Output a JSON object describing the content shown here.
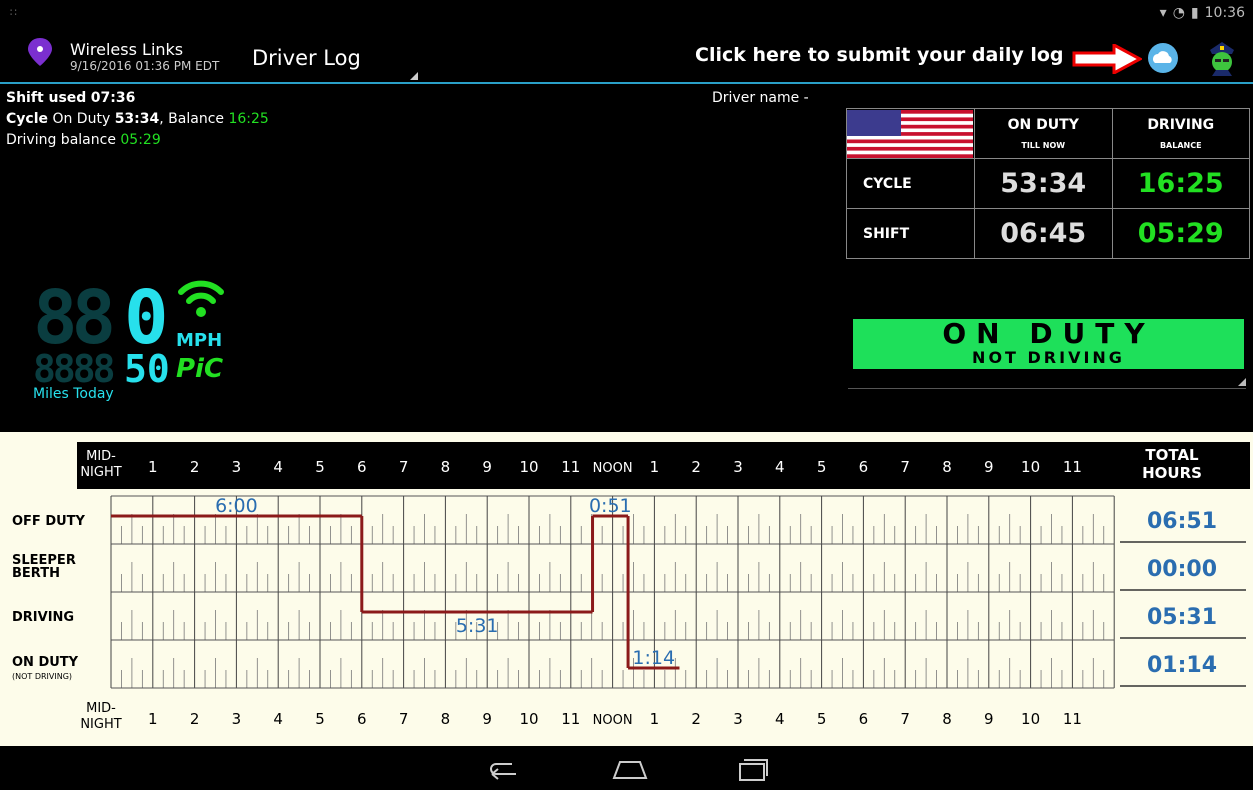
{
  "status_bar": {
    "time": "10:36",
    "icons": [
      "location-icon",
      "wifi-icon",
      "battery-icon"
    ]
  },
  "action_bar": {
    "app_name": "Wireless Links",
    "app_date": "9/16/2016 01:36 PM EDT",
    "screen_title": "Driver Log",
    "submit_hint": "Click here to submit your daily log"
  },
  "info": {
    "shift_label": "Shift used",
    "shift_value": "07:36",
    "cycle_label": "Cycle",
    "cycle_onduty_label": "On Duty",
    "cycle_onduty_value": "53:34",
    "balance_label": ", Balance",
    "balance_value": "16:25",
    "driving_balance_label": "Driving balance",
    "driving_balance_value": "05:29",
    "driver_name_label": "Driver name -"
  },
  "summary": {
    "col1_title": "ON DUTY",
    "col1_sub": "TILL NOW",
    "col2_title": "DRIVING",
    "col2_sub": "BALANCE",
    "rows": [
      {
        "label": "CYCLE",
        "on_duty": "53:34",
        "driving": "16:25"
      },
      {
        "label": "SHIFT",
        "on_duty": "06:45",
        "driving": "05:29"
      }
    ]
  },
  "status_banner": {
    "line1": "ON DUTY",
    "line2": "NOT DRIVING"
  },
  "speed": {
    "dim_digits": "88",
    "lit_digit": "0",
    "unit": "MPH",
    "odo_dim": "8888",
    "odo_lit": "50",
    "pic": "PiC",
    "miles_today": "Miles Today"
  },
  "log_grid": {
    "hour_labels": [
      "MID-NIGHT",
      "1",
      "2",
      "3",
      "4",
      "5",
      "6",
      "7",
      "8",
      "9",
      "10",
      "11",
      "NOON",
      "1",
      "2",
      "3",
      "4",
      "5",
      "6",
      "7",
      "8",
      "9",
      "10",
      "11"
    ],
    "total_header": "TOTAL HOURS",
    "rows": [
      {
        "label": "OFF DUTY",
        "sublabel": "",
        "total": "06:51"
      },
      {
        "label": "SLEEPER BERTH",
        "sublabel": "",
        "total": "00:00"
      },
      {
        "label": "DRIVING",
        "sublabel": "",
        "total": "05:31"
      },
      {
        "label": "ON DUTY",
        "sublabel": "(NOT DRIVING)",
        "total": "01:14"
      }
    ],
    "segments": [
      {
        "status_row": 0,
        "start_hour": 0,
        "end_hour": 6.0,
        "label": "6:00"
      },
      {
        "status_row": 2,
        "start_hour": 6.0,
        "end_hour": 11.52,
        "label": "5:31"
      },
      {
        "status_row": 0,
        "start_hour": 11.52,
        "end_hour": 12.37,
        "label": "0:51"
      },
      {
        "status_row": 3,
        "start_hour": 12.37,
        "end_hour": 13.6,
        "label": "1:14"
      }
    ],
    "line_color": "#8b1a1a",
    "label_color": "#2a6db0"
  },
  "nav": {
    "buttons": [
      "back-icon",
      "home-icon",
      "recents-icon"
    ]
  }
}
